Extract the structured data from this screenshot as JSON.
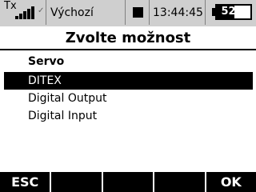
{
  "status_bar": {
    "tx_label": "Tx",
    "signal_level": 5,
    "signal_max": 5,
    "model_name": "Výchozí",
    "timer_state": "stopped",
    "clock": "13:44:45",
    "battery_percent_label": "52%",
    "battery_fraction": 0.52
  },
  "dialog": {
    "title": "Zvolte možnost",
    "header": "Servo",
    "options": [
      {
        "label": "DITEX",
        "selected": true
      },
      {
        "label": "Digital Output",
        "selected": false
      },
      {
        "label": "Digital Input",
        "selected": false
      }
    ]
  },
  "softkeys": {
    "f1": "ESC",
    "f2": "",
    "f3": "",
    "f4": "",
    "f5": "OK"
  },
  "colors": {
    "status_bg": "#cfcfcf",
    "highlight_bg": "#000000",
    "highlight_fg": "#ffffff"
  }
}
